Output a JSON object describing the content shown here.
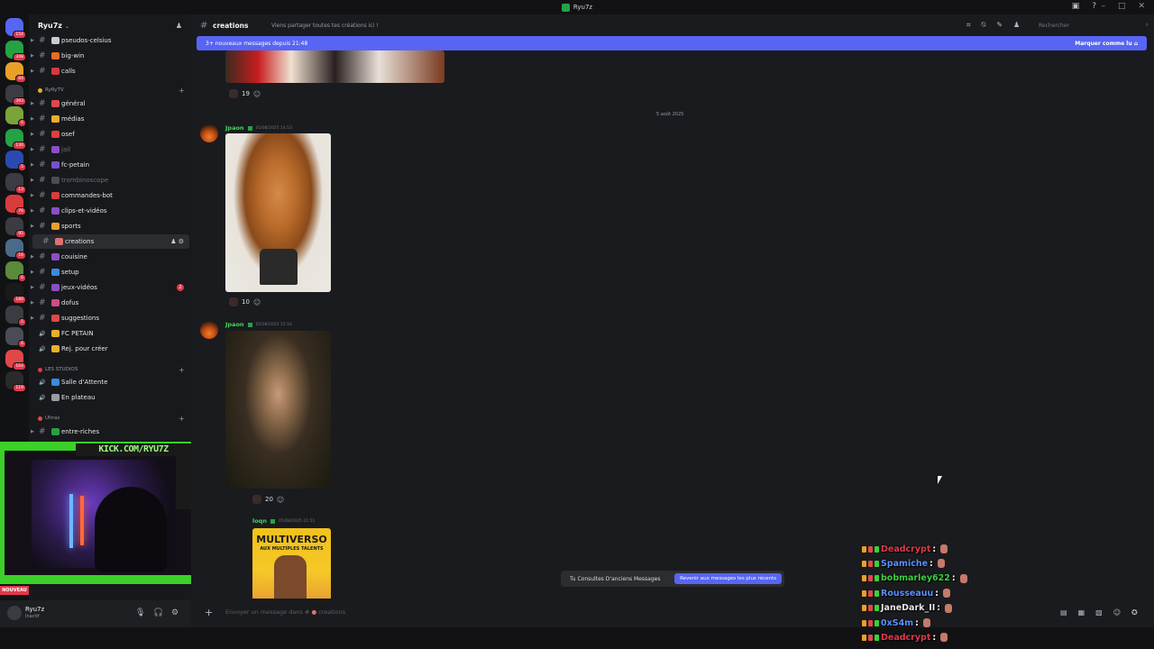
{
  "window": {
    "title": "Ryu7z"
  },
  "servers": {
    "badges": [
      "154",
      "348",
      "84",
      "393",
      "6",
      "130",
      "5",
      "13",
      "76",
      "95",
      "16",
      "6",
      "180",
      "5",
      "6",
      "164",
      "119"
    ]
  },
  "channel_list": {
    "guild_name": "Ryu7z",
    "channels_top": [
      {
        "name": "pseudos-celsius",
        "color": "#c9cbd0"
      },
      {
        "name": "big-win",
        "color": "#e86b2a"
      },
      {
        "name": "calls",
        "color": "#d63a3a"
      }
    ],
    "category_ryry": "RyRyTV",
    "channels_ryry": [
      {
        "name": "général",
        "color": "#e04848",
        "muted": false
      },
      {
        "name": "médias",
        "color": "#e8b028",
        "muted": false
      },
      {
        "name": "osef",
        "color": "#e23c3c",
        "muted": false
      },
      {
        "name": "jail",
        "color": "#8a4fc7",
        "muted": true
      },
      {
        "name": "fc-petain",
        "color": "#7a4fd0",
        "muted": false
      },
      {
        "name": "trombinoscope",
        "color": "#4a4c55",
        "muted": true
      },
      {
        "name": "commandes-bot",
        "color": "#d83d3d",
        "muted": false
      },
      {
        "name": "clips-et-vidéos",
        "color": "#8a4fc7",
        "muted": false
      },
      {
        "name": "sports",
        "color": "#e8a028",
        "muted": false
      },
      {
        "name": "creations",
        "color": "#e07070",
        "muted": false,
        "active": true
      },
      {
        "name": "couisine",
        "color": "#8a4fc7",
        "muted": false
      },
      {
        "name": "setup",
        "color": "#3a8ae0",
        "muted": false
      },
      {
        "name": "jeux-vidéos",
        "color": "#8a4fc7",
        "muted": false,
        "count": "2"
      },
      {
        "name": "dofus",
        "color": "#d04a8a",
        "muted": false
      },
      {
        "name": "suggestions",
        "color": "#e04848",
        "muted": false
      }
    ],
    "voice_ryry": [
      {
        "name": "FC PETAIN",
        "color": "#e8b028"
      },
      {
        "name": "Rej. pour créer",
        "color": "#e8b028"
      }
    ],
    "category_studios": "LES STUDIOS",
    "voice_studios": [
      {
        "name": "Salle d'Attente",
        "color": "#3a8ae0"
      },
      {
        "name": "En plateau",
        "color": "#9a9ca3"
      }
    ],
    "category_ultras": "Ultras",
    "channels_ultras": [
      {
        "name": "entre-riches",
        "color": "#25a244"
      }
    ]
  },
  "stream_overlay": {
    "banner": "KICK.COM/RYU7Z",
    "nouveau": "NOUVEAU"
  },
  "user": {
    "name": "Ryu7z",
    "status": "Inactif"
  },
  "header": {
    "channel": "creations",
    "topic": "Viens partager toutes tes créations ici !",
    "search_placeholder": "Rechercher"
  },
  "new_messages_bar": {
    "text": "3+ nouveaux messages depuis 21:48",
    "action": "Marquer comme lu"
  },
  "messages": {
    "first_reaction": "19",
    "date_divider": "5 août 2025",
    "posts": [
      {
        "author": "Jpaon",
        "timestamp": "05/08/2025 14:53",
        "reaction": "10"
      },
      {
        "author": "Jpaon",
        "timestamp": "05/08/2025 15:16",
        "reaction": "20"
      },
      {
        "author": "loqn",
        "timestamp": "05/08/2025 21:51"
      }
    ],
    "image_text": {
      "line1": "MULTIVERSO",
      "line2": "AUX MULTIPLES TALENTS"
    }
  },
  "old_messages": {
    "notice": "Tu Consultes D'anciens Messages",
    "button": "Revenir aux messages les plus récents"
  },
  "composer": {
    "placeholder": "Envoyer un message dans #",
    "channel": "creations"
  },
  "stream_chat": [
    {
      "user": "Deadcrypt",
      "color": "#e0384b"
    },
    {
      "user": "Spamiche",
      "color": "#5a8fff"
    },
    {
      "user": "bobmarley622",
      "color": "#3ad13a"
    },
    {
      "user": "Rousseauu",
      "color": "#5a8fff"
    },
    {
      "user": "JaneDark_II",
      "color": "#e8e8e8"
    },
    {
      "user": "0xS4m",
      "color": "#5a8fff"
    },
    {
      "user": "Deadcrypt",
      "color": "#e0384b"
    }
  ]
}
